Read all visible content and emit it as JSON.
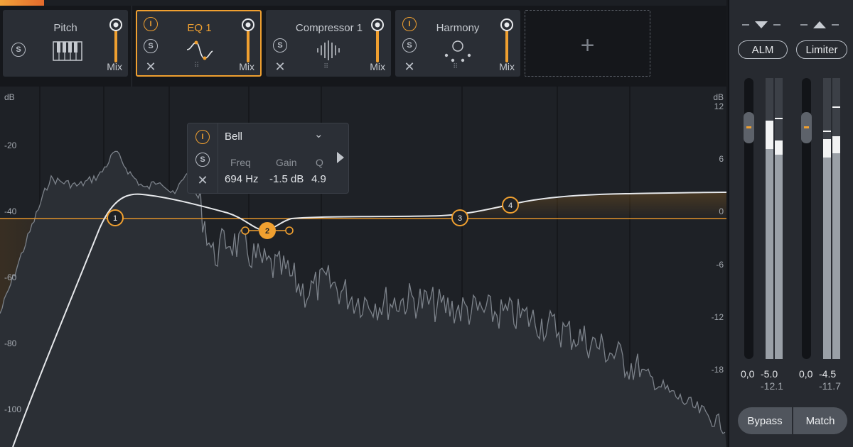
{
  "modules": [
    {
      "name": "Pitch",
      "mix": "Mix"
    },
    {
      "name": "EQ 1",
      "mix": "Mix"
    },
    {
      "name": "Compressor 1",
      "mix": "Mix"
    },
    {
      "name": "Harmony",
      "mix": "Mix"
    }
  ],
  "controls": {
    "solo": "S",
    "power": "I",
    "add": "+"
  },
  "eq": {
    "left_unit": "dB",
    "left_ticks": [
      "-20",
      "-40",
      "-60",
      "-80",
      "-100"
    ],
    "right_unit": "dB",
    "right_ticks": [
      "12",
      "6",
      "0",
      "-6",
      "-12",
      "-18"
    ],
    "nodes": [
      "1",
      "2",
      "3",
      "4"
    ],
    "selected_band": {
      "type": "Bell",
      "headers": [
        "Freq",
        "Gain",
        "Q"
      ],
      "values": [
        "694 Hz",
        "-1.5 dB",
        "4.9"
      ]
    }
  },
  "output": {
    "alm_label": "ALM",
    "limiter_label": "Limiter",
    "left": {
      "gain": "0,0",
      "peak": "-5.0",
      "rms": "-12.1"
    },
    "right": {
      "gain": "0,0",
      "peak": "-4.5",
      "rms": "-11.7"
    },
    "bypass_label": "Bypass",
    "match_label": "Match"
  },
  "colors": {
    "accent": "#f0a030",
    "background": "#1e2126",
    "panel": "#2a2e35"
  }
}
